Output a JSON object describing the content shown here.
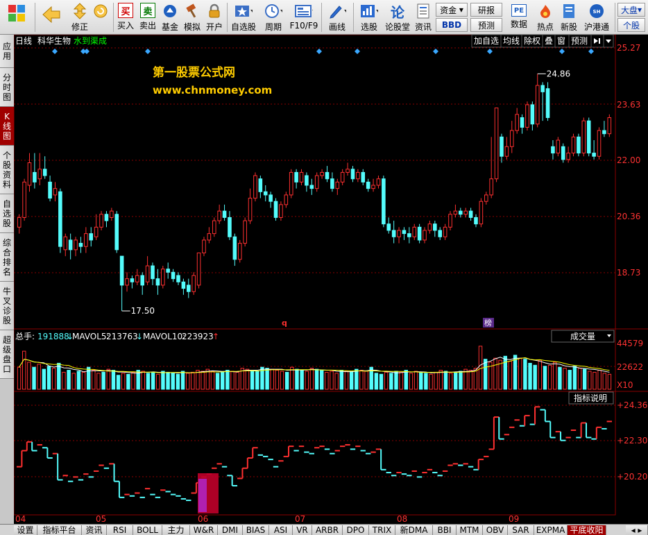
{
  "toolbar": {
    "items": [
      {
        "key": "menu",
        "label": "",
        "icon": "grid-menu-icon"
      },
      {
        "key": "back",
        "label": "",
        "icon": "back-arrow-icon"
      },
      {
        "key": "edit",
        "label": "修正",
        "icon": "up-down-arrows-icon"
      },
      {
        "key": "buy",
        "label": "买入",
        "icon": "buy-icon",
        "glyph": "买"
      },
      {
        "key": "sell",
        "label": "卖出",
        "icon": "sell-icon",
        "glyph": "卖"
      },
      {
        "key": "fund",
        "label": "基金",
        "icon": "fund-icon"
      },
      {
        "key": "sim",
        "label": "模拟",
        "icon": "hammer-icon"
      },
      {
        "key": "open",
        "label": "开户",
        "icon": "lock-icon"
      },
      {
        "key": "watch",
        "label": "自选股",
        "icon": "star-icon"
      },
      {
        "key": "period",
        "label": "周期",
        "icon": "clock-icon"
      },
      {
        "key": "f10",
        "label": "F10/F9",
        "icon": "f10-icon"
      },
      {
        "key": "draw",
        "label": "画线",
        "icon": "pen-icon"
      },
      {
        "key": "pick",
        "label": "选股",
        "icon": "chart-pick-icon"
      },
      {
        "key": "forum",
        "label": "论股堂",
        "icon": "forum-icon",
        "glyph": "论"
      },
      {
        "key": "info",
        "label": "资讯",
        "icon": "document-icon"
      },
      {
        "key": "data",
        "label": "数据",
        "icon": "pe-icon",
        "glyph": "PE"
      },
      {
        "key": "hot",
        "label": "热点",
        "icon": "fire-icon"
      },
      {
        "key": "newstock",
        "label": "新股",
        "icon": "newstock-icon"
      },
      {
        "key": "hk",
        "label": "沪港通",
        "icon": "hk-icon"
      }
    ],
    "funds_label": "资金",
    "bbd_label": "BBD",
    "research_label": "研报",
    "forecast_label": "预测",
    "market_label": "大盘",
    "stock_label": "个股"
  },
  "left_tabs": [
    {
      "label": "应用",
      "active": false
    },
    {
      "label": "分时图",
      "active": false
    },
    {
      "label": "K线图",
      "active": true
    },
    {
      "label": "个股资料",
      "active": false
    },
    {
      "label": "自选股",
      "active": false
    },
    {
      "label": "综合排名",
      "active": false
    },
    {
      "label": "牛叉诊股",
      "active": false
    },
    {
      "label": "超级盘口",
      "active": false
    }
  ],
  "chart_header": {
    "period": "日线",
    "stock_name": "科华生物",
    "indicator": "水到渠成",
    "buttons": [
      "加自选",
      "均线",
      "除权",
      "叠",
      "窗",
      "预测"
    ]
  },
  "watermark": {
    "line1": "第一股票公式网",
    "line2": "www.chnmoney.com"
  },
  "price_axis": [
    "25.27",
    "23.63",
    "22.00",
    "20.36",
    "18.73"
  ],
  "annotations": {
    "high_label": "24.86",
    "low_label": "17.50",
    "q_marker": "q",
    "list_marker": "榜"
  },
  "volume_header": {
    "total_label": "总手:",
    "total_value": "191888",
    "total_arrow": "↓",
    "mavol5_label": "MAVOL5:",
    "mavol5_value": "213763",
    "mavol5_arrow": "↓",
    "mavol10_label": "MAVOL10:",
    "mavol10_value": "223923",
    "mavol10_arrow": "↑",
    "selector": "成交量"
  },
  "volume_axis": [
    "44579",
    "22622",
    "X10"
  ],
  "indicator_panel": {
    "help_button": "指标说明",
    "axis": [
      "+24.36",
      "+22.30",
      "+20.20"
    ]
  },
  "time_axis": [
    "04",
    "05",
    "06",
    "07",
    "08",
    "09"
  ],
  "bottom_tabs": [
    {
      "label": "设置",
      "active": false
    },
    {
      "label": "指标平台",
      "active": false
    },
    {
      "label": "资讯",
      "active": false
    },
    {
      "label": "RSI",
      "active": false
    },
    {
      "label": "BOLL",
      "active": false
    },
    {
      "label": "主力",
      "active": false
    },
    {
      "label": "W&R",
      "active": false
    },
    {
      "label": "DMI",
      "active": false
    },
    {
      "label": "BIAS",
      "active": false
    },
    {
      "label": "ASI",
      "active": false
    },
    {
      "label": "VR",
      "active": false
    },
    {
      "label": "ARBR",
      "active": false
    },
    {
      "label": "DPO",
      "active": false
    },
    {
      "label": "TRIX",
      "active": false
    },
    {
      "label": "新DMA",
      "active": false
    },
    {
      "label": "BBI",
      "active": false
    },
    {
      "label": "MTM",
      "active": false
    },
    {
      "label": "OBV",
      "active": false
    },
    {
      "label": "SAR",
      "active": false
    },
    {
      "label": "EXPMA",
      "active": false
    },
    {
      "label": "平底收阳",
      "active": true
    }
  ],
  "colors": {
    "up": "#ff3030",
    "down": "#54fcfc",
    "grid": "#8b0000",
    "axis_text": "#ff3232",
    "accent": "#a00000",
    "ma_white": "#ffffff",
    "ma_yellow": "#ffff00",
    "watermark": "#ffcc00"
  },
  "chart_data": {
    "type": "candlestick",
    "price_range": [
      17.2,
      25.6
    ],
    "candles": [
      {
        "o": 20.1,
        "c": 20.4,
        "h": 20.5,
        "l": 19.9
      },
      {
        "o": 20.4,
        "c": 21.5,
        "h": 21.6,
        "l": 20.3
      },
      {
        "o": 21.4,
        "c": 22.1,
        "h": 22.4,
        "l": 21.2
      },
      {
        "o": 21.8,
        "c": 21.5,
        "h": 22.4,
        "l": 21.3
      },
      {
        "o": 21.6,
        "c": 21.9,
        "h": 22.4,
        "l": 21.4
      },
      {
        "o": 21.9,
        "c": 21.7,
        "h": 22.3,
        "l": 21.6
      },
      {
        "o": 21.5,
        "c": 21.0,
        "h": 21.7,
        "l": 20.9
      },
      {
        "o": 21.1,
        "c": 21.3,
        "h": 21.5,
        "l": 20.9
      },
      {
        "o": 21.2,
        "c": 19.5,
        "h": 21.3,
        "l": 19.3
      },
      {
        "o": 19.4,
        "c": 19.8,
        "h": 19.9,
        "l": 19.2
      },
      {
        "o": 19.7,
        "c": 19.4,
        "h": 19.9,
        "l": 19.1
      },
      {
        "o": 19.4,
        "c": 19.7,
        "h": 19.8,
        "l": 19.2
      },
      {
        "o": 19.6,
        "c": 19.5,
        "h": 19.8,
        "l": 19.3
      },
      {
        "o": 19.5,
        "c": 19.9,
        "h": 20.1,
        "l": 19.3
      },
      {
        "o": 19.9,
        "c": 19.7,
        "h": 20.1,
        "l": 19.5
      },
      {
        "o": 19.8,
        "c": 20.1,
        "h": 20.5,
        "l": 19.7
      },
      {
        "o": 20.1,
        "c": 20.5,
        "h": 20.6,
        "l": 20.0
      },
      {
        "o": 20.5,
        "c": 20.3,
        "h": 20.6,
        "l": 20.1
      },
      {
        "o": 20.4,
        "c": 20.6,
        "h": 20.7,
        "l": 20.3
      },
      {
        "o": 20.5,
        "c": 19.4,
        "h": 20.6,
        "l": 19.3
      },
      {
        "o": 19.2,
        "c": 18.3,
        "h": 19.2,
        "l": 17.5
      },
      {
        "o": 18.3,
        "c": 18.5,
        "h": 18.7,
        "l": 18.1
      },
      {
        "o": 18.5,
        "c": 18.4,
        "h": 18.6,
        "l": 18.2
      },
      {
        "o": 18.4,
        "c": 18.6,
        "h": 18.8,
        "l": 18.3
      },
      {
        "o": 18.6,
        "c": 18.3,
        "h": 18.7,
        "l": 18.0
      },
      {
        "o": 18.4,
        "c": 18.9,
        "h": 19.2,
        "l": 18.3
      },
      {
        "o": 18.9,
        "c": 18.5,
        "h": 19.0,
        "l": 18.3
      },
      {
        "o": 18.5,
        "c": 18.3,
        "h": 18.8,
        "l": 18.0
      },
      {
        "o": 18.3,
        "c": 18.8,
        "h": 18.9,
        "l": 18.2
      },
      {
        "o": 18.8,
        "c": 18.7,
        "h": 19.0,
        "l": 18.5
      },
      {
        "o": 18.7,
        "c": 18.5,
        "h": 18.8,
        "l": 18.4
      },
      {
        "o": 18.6,
        "c": 18.4,
        "h": 18.7,
        "l": 18.3
      },
      {
        "o": 18.4,
        "c": 18.2,
        "h": 18.5,
        "l": 18.0
      },
      {
        "o": 18.3,
        "c": 18.1,
        "h": 18.5,
        "l": 17.9
      },
      {
        "o": 18.1,
        "c": 18.6,
        "h": 18.7,
        "l": 18.0
      },
      {
        "o": 18.3,
        "c": 19.3,
        "h": 19.3,
        "l": 18.2
      },
      {
        "o": 19.3,
        "c": 19.7,
        "h": 19.8,
        "l": 19.2
      },
      {
        "o": 19.7,
        "c": 19.9,
        "h": 20.1,
        "l": 19.6
      },
      {
        "o": 19.9,
        "c": 20.3,
        "h": 20.4,
        "l": 19.8
      },
      {
        "o": 20.3,
        "c": 20.6,
        "h": 20.8,
        "l": 20.2
      },
      {
        "o": 20.6,
        "c": 20.4,
        "h": 20.8,
        "l": 20.3
      },
      {
        "o": 20.4,
        "c": 19.8,
        "h": 20.6,
        "l": 19.7
      },
      {
        "o": 19.8,
        "c": 19.1,
        "h": 19.9,
        "l": 18.9
      },
      {
        "o": 19.1,
        "c": 19.6,
        "h": 19.7,
        "l": 19.0
      },
      {
        "o": 19.6,
        "c": 20.3,
        "h": 20.4,
        "l": 19.5
      },
      {
        "o": 20.3,
        "c": 21.0,
        "h": 21.3,
        "l": 20.2
      },
      {
        "o": 21.0,
        "c": 21.7,
        "h": 21.8,
        "l": 20.9
      },
      {
        "o": 21.6,
        "c": 21.2,
        "h": 21.7,
        "l": 21.0
      },
      {
        "o": 21.2,
        "c": 21.1,
        "h": 21.4,
        "l": 20.9
      },
      {
        "o": 21.1,
        "c": 20.9,
        "h": 21.2,
        "l": 20.7
      },
      {
        "o": 20.9,
        "c": 20.4,
        "h": 21.0,
        "l": 20.3
      },
      {
        "o": 20.4,
        "c": 20.8,
        "h": 20.9,
        "l": 20.3
      },
      {
        "o": 20.8,
        "c": 21.1,
        "h": 21.2,
        "l": 20.7
      },
      {
        "o": 21.1,
        "c": 21.8,
        "h": 21.9,
        "l": 21.0
      },
      {
        "o": 21.8,
        "c": 21.5,
        "h": 21.9,
        "l": 21.3
      },
      {
        "o": 21.5,
        "c": 21.8,
        "h": 21.9,
        "l": 21.4
      },
      {
        "o": 21.7,
        "c": 21.4,
        "h": 21.8,
        "l": 21.2
      },
      {
        "o": 21.4,
        "c": 21.3,
        "h": 21.6,
        "l": 21.1
      },
      {
        "o": 21.3,
        "c": 21.7,
        "h": 21.8,
        "l": 21.2
      },
      {
        "o": 21.7,
        "c": 21.8,
        "h": 21.9,
        "l": 21.6
      },
      {
        "o": 21.8,
        "c": 21.6,
        "h": 22.0,
        "l": 21.5
      },
      {
        "o": 21.6,
        "c": 21.3,
        "h": 21.8,
        "l": 21.2
      },
      {
        "o": 21.3,
        "c": 21.5,
        "h": 21.6,
        "l": 21.1
      },
      {
        "o": 21.5,
        "c": 21.8,
        "h": 21.9,
        "l": 21.4
      },
      {
        "o": 21.8,
        "c": 21.9,
        "h": 22.1,
        "l": 21.7
      },
      {
        "o": 21.9,
        "c": 21.6,
        "h": 22.0,
        "l": 21.5
      },
      {
        "o": 21.6,
        "c": 21.8,
        "h": 21.9,
        "l": 21.5
      },
      {
        "o": 21.8,
        "c": 21.5,
        "h": 21.9,
        "l": 21.4
      },
      {
        "o": 21.5,
        "c": 21.3,
        "h": 21.6,
        "l": 21.2
      },
      {
        "o": 21.3,
        "c": 21.4,
        "h": 21.6,
        "l": 21.2
      },
      {
        "o": 21.4,
        "c": 21.6,
        "h": 21.7,
        "l": 21.3
      },
      {
        "o": 21.6,
        "c": 20.2,
        "h": 21.7,
        "l": 20.1
      },
      {
        "o": 20.2,
        "c": 20.0,
        "h": 20.4,
        "l": 19.9
      },
      {
        "o": 20.0,
        "c": 19.8,
        "h": 20.3,
        "l": 19.6
      },
      {
        "o": 19.8,
        "c": 20.0,
        "h": 20.1,
        "l": 19.6
      },
      {
        "o": 20.0,
        "c": 19.9,
        "h": 20.1,
        "l": 19.7
      },
      {
        "o": 19.9,
        "c": 19.8,
        "h": 20.1,
        "l": 19.6
      },
      {
        "o": 19.8,
        "c": 20.1,
        "h": 20.2,
        "l": 19.7
      },
      {
        "o": 20.1,
        "c": 19.7,
        "h": 20.2,
        "l": 19.6
      },
      {
        "o": 19.7,
        "c": 20.0,
        "h": 20.1,
        "l": 19.6
      },
      {
        "o": 20.0,
        "c": 20.2,
        "h": 20.3,
        "l": 19.9
      },
      {
        "o": 20.2,
        "c": 20.0,
        "h": 20.3,
        "l": 19.8
      },
      {
        "o": 20.0,
        "c": 19.8,
        "h": 20.1,
        "l": 19.7
      },
      {
        "o": 19.8,
        "c": 20.1,
        "h": 20.2,
        "l": 19.7
      },
      {
        "o": 20.1,
        "c": 20.5,
        "h": 20.6,
        "l": 20.0
      },
      {
        "o": 20.5,
        "c": 20.6,
        "h": 20.8,
        "l": 20.4
      },
      {
        "o": 20.6,
        "c": 20.5,
        "h": 20.7,
        "l": 20.4
      },
      {
        "o": 20.5,
        "c": 20.6,
        "h": 20.7,
        "l": 20.4
      },
      {
        "o": 20.6,
        "c": 20.4,
        "h": 20.7,
        "l": 20.3
      },
      {
        "o": 20.4,
        "c": 20.2,
        "h": 20.5,
        "l": 20.1
      },
      {
        "o": 20.2,
        "c": 20.9,
        "h": 21.0,
        "l": 20.1
      },
      {
        "o": 20.9,
        "c": 21.1,
        "h": 21.2,
        "l": 20.8
      },
      {
        "o": 21.1,
        "c": 21.6,
        "h": 22.9,
        "l": 21.0
      },
      {
        "o": 21.6,
        "c": 23.8,
        "h": 23.8,
        "l": 21.5
      },
      {
        "o": 22.9,
        "c": 22.3,
        "h": 23.0,
        "l": 22.1
      },
      {
        "o": 22.3,
        "c": 22.6,
        "h": 22.9,
        "l": 22.2
      },
      {
        "o": 22.6,
        "c": 23.1,
        "h": 23.4,
        "l": 22.4
      },
      {
        "o": 23.1,
        "c": 23.6,
        "h": 23.8,
        "l": 23.0
      },
      {
        "o": 23.5,
        "c": 23.2,
        "h": 23.6,
        "l": 23.0
      },
      {
        "o": 23.2,
        "c": 23.9,
        "h": 24.0,
        "l": 23.1
      },
      {
        "o": 23.9,
        "c": 23.3,
        "h": 24.0,
        "l": 23.1
      },
      {
        "o": 23.3,
        "c": 24.5,
        "h": 24.86,
        "l": 23.2
      },
      {
        "o": 24.5,
        "c": 24.3,
        "h": 24.6,
        "l": 23.4
      },
      {
        "o": 24.4,
        "c": 23.5,
        "h": 24.6,
        "l": 23.4
      },
      {
        "o": 22.6,
        "c": 22.4,
        "h": 22.8,
        "l": 22.2
      },
      {
        "o": 22.4,
        "c": 22.8,
        "h": 22.9,
        "l": 22.3
      },
      {
        "o": 22.6,
        "c": 22.2,
        "h": 22.7,
        "l": 22.1
      },
      {
        "o": 22.2,
        "c": 22.4,
        "h": 22.6,
        "l": 22.1
      },
      {
        "o": 22.4,
        "c": 22.9,
        "h": 23.0,
        "l": 22.3
      },
      {
        "o": 22.9,
        "c": 22.4,
        "h": 23.0,
        "l": 22.3
      },
      {
        "o": 22.4,
        "c": 23.4,
        "h": 23.5,
        "l": 22.3
      },
      {
        "o": 23.4,
        "c": 22.4,
        "h": 23.5,
        "l": 22.3
      },
      {
        "o": 22.4,
        "c": 22.3,
        "h": 22.8,
        "l": 22.2
      },
      {
        "o": 22.3,
        "c": 23.1,
        "h": 23.2,
        "l": 22.2
      },
      {
        "o": 23.1,
        "c": 23.0,
        "h": 23.4,
        "l": 22.9
      },
      {
        "o": 23.0,
        "c": 23.5,
        "h": 23.6,
        "l": 22.9
      }
    ],
    "volumes": [
      22,
      38,
      27,
      22,
      25,
      20,
      23,
      21,
      26,
      17,
      19,
      16,
      18,
      17,
      22,
      19,
      16,
      17,
      20,
      19,
      14,
      16,
      15,
      17,
      19,
      18,
      16,
      17,
      15,
      18,
      17,
      16,
      15,
      18,
      16,
      17,
      19,
      18,
      20,
      18,
      16,
      17,
      19,
      18,
      17,
      21,
      20,
      19,
      18,
      22,
      21,
      20,
      19,
      18,
      17,
      22,
      20,
      19,
      18,
      21,
      20,
      19,
      17,
      18,
      16,
      19,
      18,
      17,
      20,
      19,
      18,
      22,
      16,
      15,
      17,
      16,
      18,
      17,
      19,
      16,
      18,
      17,
      16,
      15,
      17,
      19,
      18,
      16,
      17,
      18,
      20,
      19,
      21,
      43,
      30,
      27,
      31,
      29,
      33,
      28,
      34,
      31,
      30,
      26,
      24,
      29,
      23,
      24,
      27,
      22,
      21,
      19,
      23,
      21,
      20,
      18,
      17,
      19,
      16,
      15
    ],
    "ma5_label": "MAVOL5",
    "ma10_label": "MAVOL10"
  }
}
